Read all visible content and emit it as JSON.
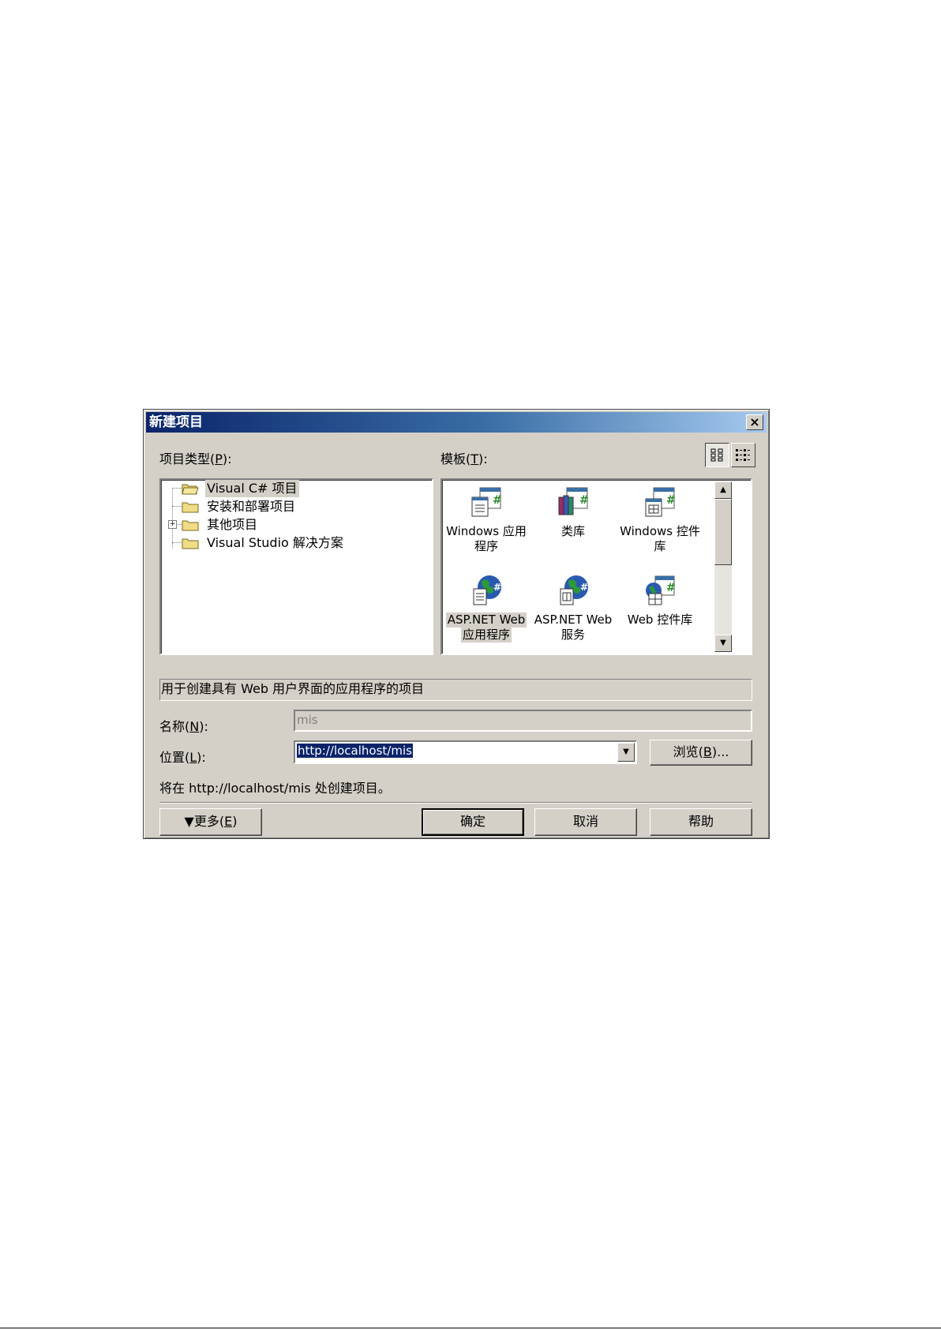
{
  "dialog": {
    "title": "新建项目",
    "close_glyph": "×",
    "project_types_label": "项目类型(",
    "project_types_key": "P",
    "project_types_label_end": "):",
    "templates_label": "模板(",
    "templates_key": "T",
    "templates_label_end": "):",
    "view_large_icons": "large-icons-view-icon",
    "view_small_icons": "list-view-icon",
    "tree": [
      {
        "label": "Visual C# 项目",
        "selected": true,
        "expandable": false
      },
      {
        "label": "安装和部署项目",
        "selected": false,
        "expandable": false
      },
      {
        "label": "其他项目",
        "selected": false,
        "expandable": true
      },
      {
        "label": "Visual Studio 解决方案",
        "selected": false,
        "expandable": false
      }
    ],
    "templates": [
      {
        "line1": "Windows 应用",
        "line2": "程序",
        "icon": "windows-app-icon",
        "selected": false
      },
      {
        "line1": "类库",
        "line2": "",
        "icon": "class-library-icon",
        "selected": false
      },
      {
        "line1": "Windows 控件",
        "line2": "库",
        "icon": "windows-control-library-icon",
        "selected": false
      },
      {
        "line1": "ASP.NET Web",
        "line2": "应用程序",
        "icon": "aspnet-web-app-icon",
        "selected": true
      },
      {
        "line1": "ASP.NET Web",
        "line2": "服务",
        "icon": "aspnet-web-service-icon",
        "selected": false
      },
      {
        "line1": "Web 控件库",
        "line2": "",
        "icon": "web-control-library-icon",
        "selected": false
      }
    ],
    "description": "用于创建具有 Web 用户界面的应用程序的项目",
    "name_label": "名称(",
    "name_key": "N",
    "name_label_end": "):",
    "name_value": "mis",
    "location_label": "位置(",
    "location_key": "L",
    "location_label_end": "):",
    "location_value": "http://localhost/mis",
    "browse_label": "浏览(",
    "browse_key": "B",
    "browse_label_end": ")...",
    "create_note": "将在 http://localhost/mis 处创建项目。",
    "more_label": "更多(",
    "more_key": "E",
    "more_label_end": ")",
    "ok_label": "确定",
    "cancel_label": "取消",
    "help_label": "帮助"
  },
  "colors": {
    "dialog_face": "#d4d0c8",
    "title_gradient_start": "#0a246a",
    "title_gradient_end": "#a6caf0",
    "selection": "#0a246a"
  }
}
